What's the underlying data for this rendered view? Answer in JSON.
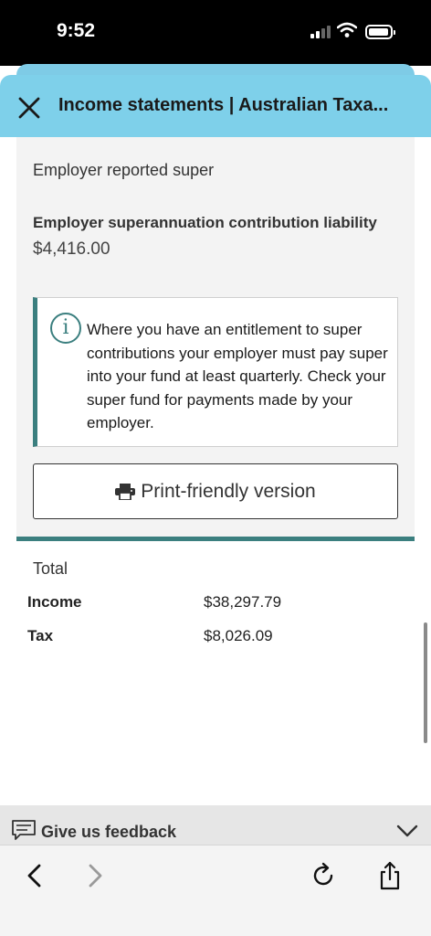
{
  "status_bar": {
    "time": "9:52"
  },
  "header": {
    "title": "Income statements | Australian Taxa..."
  },
  "super_section": {
    "heading": "Employer reported super",
    "liability_label": "Employer superannuation contribution liability",
    "liability_value": "$4,416.00"
  },
  "info_box": {
    "icon": "info-icon",
    "text": "Where you have an entitlement to super contributions your employer must pay super into your fund at least quarterly. Check your super fund for payments made by your employer."
  },
  "print_button": {
    "label": "Print-friendly version",
    "icon": "printer-icon"
  },
  "totals": {
    "heading": "Total",
    "rows": [
      {
        "label": "Income",
        "value": "$38,297.79"
      },
      {
        "label": "Tax",
        "value": "$8,026.09"
      }
    ]
  },
  "feedback": {
    "label": "Give us feedback"
  },
  "colors": {
    "header_bg": "#7ed0ea",
    "accent": "#3b7f7f",
    "card_bg": "#f3f3f3"
  }
}
